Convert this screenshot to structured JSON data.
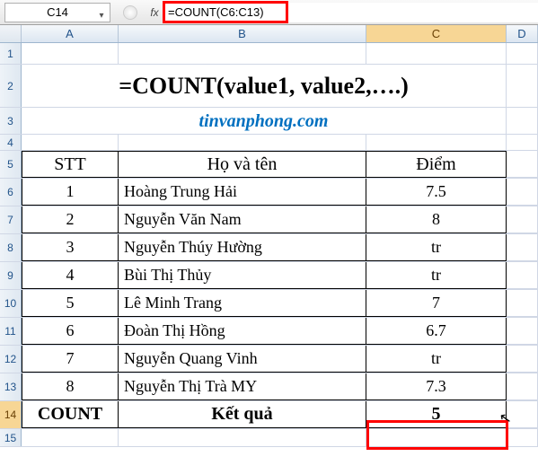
{
  "name_box": "C14",
  "fx_label": "fx",
  "formula": "=COUNT(C6:C13)",
  "columns": {
    "A": "A",
    "B": "B",
    "C": "C",
    "D": "D"
  },
  "row_numbers": [
    "1",
    "2",
    "3",
    "4",
    "5",
    "6",
    "7",
    "8",
    "9",
    "10",
    "11",
    "12",
    "13",
    "14",
    "15"
  ],
  "title": "=COUNT(value1, value2,….)",
  "website": "tinvanphong.com",
  "headers": {
    "stt": "STT",
    "name": "Họ và tên",
    "score": "Điểm"
  },
  "data": [
    {
      "stt": "1",
      "name": "Hoàng Trung Hải",
      "score": "7.5"
    },
    {
      "stt": "2",
      "name": "Nguyễn Văn Nam",
      "score": "8"
    },
    {
      "stt": "3",
      "name": "Nguyễn Thúy Hường",
      "score": "tr"
    },
    {
      "stt": "4",
      "name": "Bùi Thị Thủy",
      "score": "tr"
    },
    {
      "stt": "5",
      "name": "Lê Minh Trang",
      "score": "7"
    },
    {
      "stt": "6",
      "name": "Đoàn Thị Hồng",
      "score": "6.7"
    },
    {
      "stt": "7",
      "name": "Nguyễn Quang Vinh",
      "score": "tr"
    },
    {
      "stt": "8",
      "name": "Nguyễn Thị Trà MY",
      "score": "7.3"
    }
  ],
  "footer": {
    "label": "COUNT",
    "result_label": "Kết quả",
    "result": "5"
  }
}
